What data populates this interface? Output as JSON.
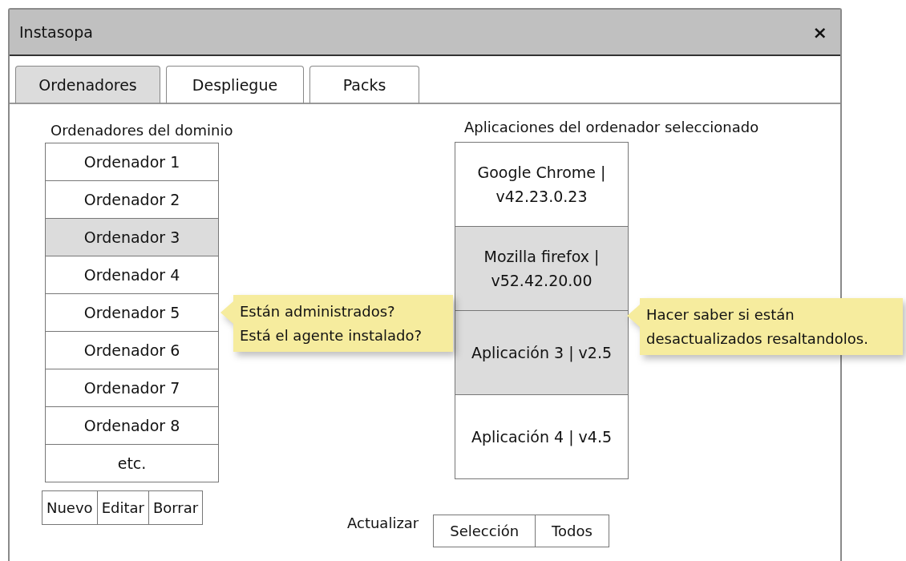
{
  "window": {
    "title": "Instasopa",
    "close": "×"
  },
  "tabs": [
    {
      "label": "Ordenadores",
      "selected": true
    },
    {
      "label": "Despliegue",
      "selected": false
    },
    {
      "label": "Packs",
      "selected": false
    }
  ],
  "computers": {
    "heading": "Ordenadores del dominio",
    "items": [
      {
        "label": "Ordenador 1",
        "selected": false
      },
      {
        "label": "Ordenador 2",
        "selected": false
      },
      {
        "label": "Ordenador 3",
        "selected": true
      },
      {
        "label": "Ordenador 4",
        "selected": false
      },
      {
        "label": "Ordenador 5",
        "selected": false
      },
      {
        "label": "Ordenador 6",
        "selected": false
      },
      {
        "label": "Ordenador 7",
        "selected": false
      },
      {
        "label": "Ordenador 8",
        "selected": false
      },
      {
        "label": "etc.",
        "selected": false
      }
    ],
    "buttons": [
      "Nuevo",
      "Editar",
      "Borrar"
    ]
  },
  "applications": {
    "heading": "Aplicaciones del ordenador seleccionado",
    "items": [
      {
        "label": "Google Chrome | v42.23.0.23",
        "highlighted": false
      },
      {
        "label": "Mozilla firefox | v52.42.20.00",
        "highlighted": true
      },
      {
        "label": "Aplicación 3 | v2.5",
        "highlighted": true
      },
      {
        "label": "Aplicación 4 | v4.5",
        "highlighted": false
      }
    ]
  },
  "notes": [
    {
      "text": "Están administrados?\nEstá el agente instalado?"
    },
    {
      "text": "Hacer saber si están\ndesactualizados resaltandolos."
    }
  ],
  "update": {
    "label": "Actualizar",
    "buttons": [
      "Selección",
      "Todos"
    ]
  }
}
